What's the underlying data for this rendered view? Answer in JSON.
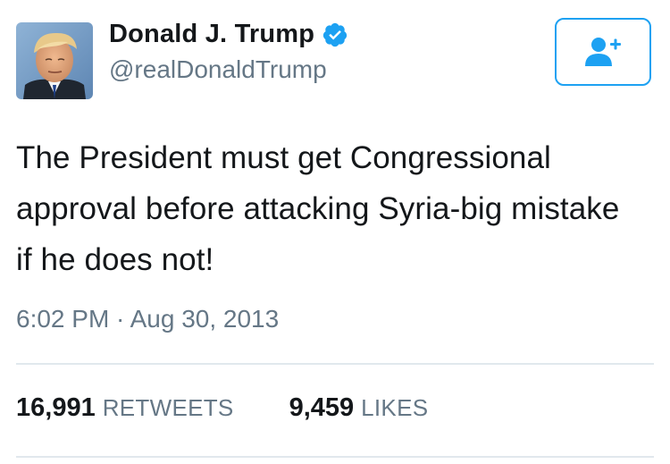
{
  "author": {
    "name": "Donald J. Trump",
    "handle": "@realDonaldTrump",
    "verified": true
  },
  "tweet": {
    "text": "The President must get Congressional approval before attacking Syria-big mistake if he does not!",
    "timestamp": "6:02 PM · Aug 30, 2013"
  },
  "stats": {
    "retweets_count": "16,991",
    "retweets_label": "RETWEETS",
    "likes_count": "9,459",
    "likes_label": "LIKES"
  },
  "icons": {
    "follow": "add-user-icon",
    "verified": "verified-badge-icon"
  },
  "colors": {
    "accent": "#1da1f2",
    "text": "#14171a",
    "secondary_text": "#657786",
    "divider": "#e1e8ed"
  }
}
